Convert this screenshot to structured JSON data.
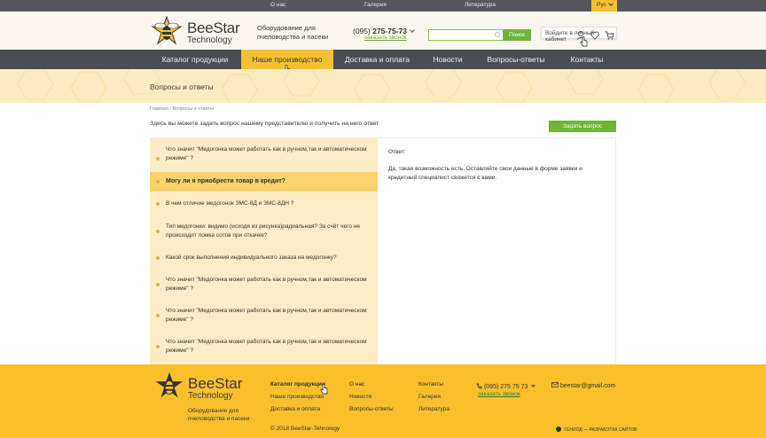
{
  "topbar": {
    "links": [
      "О нас",
      "Галерея",
      "Литература"
    ],
    "lang": "Рус"
  },
  "header": {
    "logo_line1": "BeeStar",
    "logo_line2": "Technology",
    "tagline": "Оборудование для пчеловодства и пасеки",
    "phone_prefix": "(095)",
    "phone_number": "275-75-73",
    "callback": "заказать звонок",
    "search_placeholder": "",
    "search_button": "Поиск",
    "login_tooltip": "Войдите в личный кабинет"
  },
  "nav": {
    "items": [
      "Каталог продукции",
      "Наше производство",
      "Доставка и оплата",
      "Новости",
      "Вопросы-ответы",
      "Контакты"
    ],
    "active_index": 1
  },
  "page": {
    "title": "Вопросы и ответы",
    "breadcrumb": "Главная / Вопросы и ответы",
    "intro": "Здесь вы можете задать вопрос нашему представителю и получить на него ответ",
    "ask_button": "Задать вопрос"
  },
  "faq": {
    "items": [
      "Что значит \"Медогонка может работать как в ручном,так и автоматическом режиме\" ?",
      "Могу ли я приобрести товар в кредит?",
      "В чем отличие медогонок ЗМС-8Д и ЗМС-8ДН ?",
      "Тип медогонки: видимо (исходя из рисунка)радиальная? За счёт чего не происходит ломка сотов при откачке?",
      "Какой срок выполнения индивидуального заказа на медогонку?",
      "Что значит \"Медогонка может работать как в ручном,так и автоматическом режиме\" ?",
      "Что значит \"Медогонка может работать как в ручном,так и автоматическом режиме\" ?",
      "Что значит \"Медогонка может работать как в ручном,так и автоматическом режиме\" ?"
    ],
    "active_index": 1,
    "answer_label": "Ответ:",
    "answer_text": "Да, такая возможность есть. Оставляйте свои данные в форме заявки и кредитный специалист свяжется с вами."
  },
  "footer": {
    "logo_line1": "BeeStar",
    "logo_line2": "Technology",
    "tagline": "Оборудование для пчеловодства и пасеки",
    "col1": [
      "Каталог продукции",
      "Наше производство",
      "Доставка и оплата"
    ],
    "col2": [
      "О нас",
      "Новости",
      "Вопросы-ответы"
    ],
    "col3": [
      "Контакты",
      "Галерея",
      "Литература"
    ],
    "phone": "(095) 275 75 73",
    "callback": "заказать звонок",
    "email": "beestar@gmail.com",
    "copyright": "© 2018 BeeStar-Tehnology",
    "developer": "ГЕНИОД — РАЗРАБОТКА САЙТОВ"
  },
  "colors": {
    "accent_yellow": "#f7c12e",
    "dark_nav": "#4a4e53",
    "green": "#6fb43b",
    "faq_bg": "#fbedc5",
    "faq_active": "#fad26b"
  }
}
